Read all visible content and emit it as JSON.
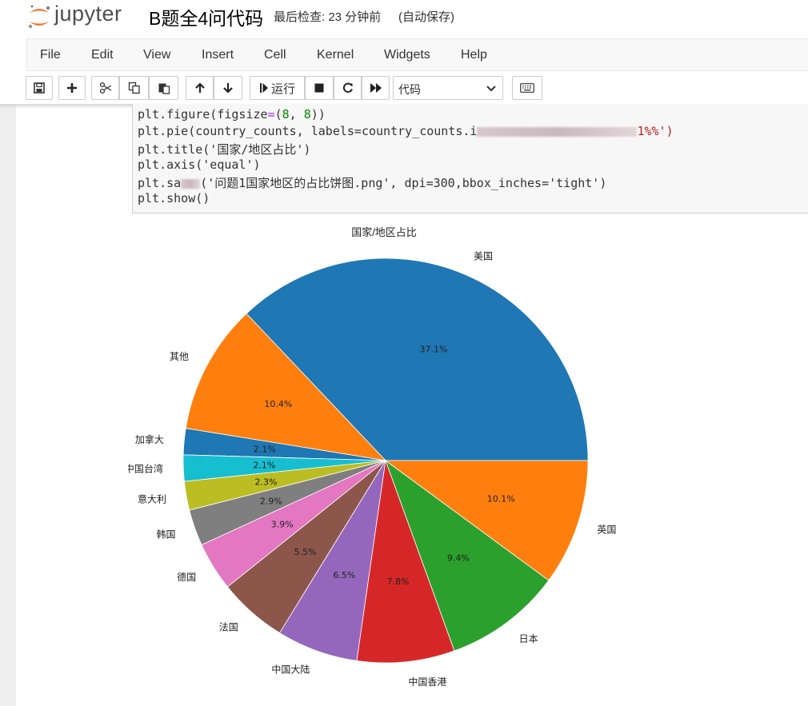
{
  "header": {
    "app_name": "jupyter",
    "notebook_title": "B题全4问代码",
    "checkpoint": "最后检查: 23 分钟前",
    "autosave": "(自动保存)"
  },
  "menu": [
    "File",
    "Edit",
    "View",
    "Insert",
    "Cell",
    "Kernel",
    "Widgets",
    "Help"
  ],
  "toolbar": {
    "run_label": "运行",
    "cell_type": "代码",
    "icons": [
      "save-icon",
      "plus-icon",
      "cut-icon",
      "copy-icon",
      "paste-icon",
      "arrow-up-icon",
      "arrow-down-icon",
      "run-icon",
      "stop-icon",
      "restart-icon",
      "fast-forward-icon",
      "keyboard-icon"
    ]
  },
  "code": {
    "line1": "plt.figure(figsize=(8, 8))",
    "line2": "plt.pie(country_counts, labels=country_counts.i",
    "line2_tail": "1%%')",
    "line3": "plt.title('国家/地区占比')",
    "line4": "plt.axis('equal')",
    "line5_a": "plt.sa",
    "line5_b": "('问题1国家地区的占比饼图.png', dpi=300,bbox_inches='tight')",
    "line6": "plt.show()"
  },
  "chart_data": {
    "type": "pie",
    "title": "国家/地区占比",
    "labels": [
      "美国",
      "其他",
      "加拿大",
      "中国台湾",
      "意大利",
      "韩国",
      "德国",
      "法国",
      "中国大陆",
      "中国香港",
      "日本",
      "英国"
    ],
    "values": [
      37.1,
      10.4,
      2.1,
      2.1,
      2.3,
      2.9,
      3.9,
      5.5,
      6.5,
      7.8,
      9.4,
      10.1
    ],
    "autopct": [
      "37.1%",
      "10.4%",
      "2.1%",
      "2.1%",
      "2.3%",
      "2.9%",
      "3.9%",
      "5.5%",
      "6.5%",
      "7.8%",
      "9.4%",
      "10.1%"
    ],
    "colors": [
      "#1f77b4",
      "#ff7f0e",
      "#1f77b4",
      "#17becf",
      "#bcbd22",
      "#7f7f7f",
      "#e377c2",
      "#8c564b",
      "#9467bd",
      "#d62728",
      "#2ca02c",
      "#ff7f0e"
    ]
  }
}
